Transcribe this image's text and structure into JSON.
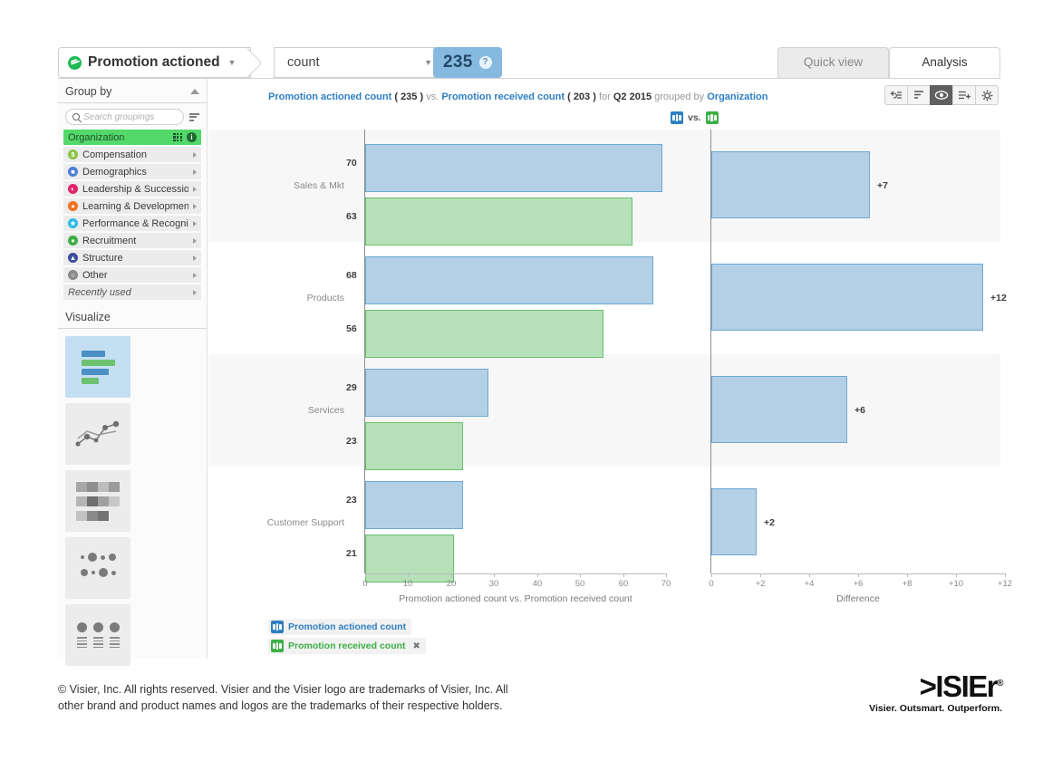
{
  "topbar": {
    "metric_name": "Promotion actioned",
    "metric_icon": "promotion-icon",
    "aggregation": "count",
    "value": "235",
    "help_badge": "?"
  },
  "view_tabs": [
    {
      "label": "Quick view",
      "active": false
    },
    {
      "label": "Analysis",
      "active": true
    }
  ],
  "sidebar": {
    "group_by_title": "Group by",
    "search_placeholder": "Search groupings",
    "items": [
      {
        "label": "Organization",
        "active": true,
        "color": "#53d86a"
      },
      {
        "label": "Compensation",
        "active": false,
        "color": "#8bc540",
        "glyph": "$"
      },
      {
        "label": "Demographics",
        "active": false,
        "color": "#4a7fd4",
        "glyph": "■"
      },
      {
        "label": "Leadership & Succession",
        "active": false,
        "color": "#e0246a",
        "glyph": "◔"
      },
      {
        "label": "Learning & Development",
        "active": false,
        "color": "#f4701f",
        "glyph": "ⓘ"
      },
      {
        "label": "Performance & Recognition",
        "active": false,
        "color": "#27b9e8",
        "glyph": "★"
      },
      {
        "label": "Recruitment",
        "active": false,
        "color": "#3dae46",
        "glyph": "⑂"
      },
      {
        "label": "Structure",
        "active": false,
        "color": "#3a4fa0",
        "glyph": "▲"
      },
      {
        "label": "Other",
        "active": false,
        "color": "#8a8a8a",
        "glyph": "●"
      },
      {
        "label": "Recently used",
        "active": false,
        "recent": true
      }
    ],
    "visualize_title": "Visualize",
    "visualizations": [
      {
        "name": "bar-chart",
        "selected": true
      },
      {
        "name": "line-chart",
        "selected": false
      },
      {
        "name": "heatmap-chart",
        "selected": false
      },
      {
        "name": "bubble-chart",
        "selected": false
      },
      {
        "name": "profile-table",
        "selected": false
      }
    ]
  },
  "breadcrumb": {
    "metric_a": "Promotion actioned count",
    "value_a": "( 235 )",
    "vs": "vs.",
    "metric_b": "Promotion received count",
    "value_b": "( 203 )",
    "for": "for",
    "period": "Q2 2015",
    "grouped_by": "grouped by",
    "group": "Organization"
  },
  "toolbar": [
    {
      "name": "undo-list-icon",
      "active": false
    },
    {
      "name": "sort-bars-icon",
      "active": false
    },
    {
      "name": "eye-icon",
      "active": true
    },
    {
      "name": "add-list-icon",
      "active": false
    },
    {
      "name": "gear-icon",
      "active": false
    }
  ],
  "vs_header": {
    "vs_text": "vs."
  },
  "legend": [
    {
      "label": "Promotion actioned count",
      "color": "#2e7fc1",
      "removable": false
    },
    {
      "label": "Promotion received count",
      "color": "#3dae46",
      "removable": true,
      "remove": "✖"
    }
  ],
  "chart_data": {
    "type": "bar",
    "title": "Promotion actioned count ( 235 ) vs. Promotion received count ( 203 ) for Q2 2015 grouped by Organization",
    "orientation": "horizontal",
    "categories": [
      "Sales & Mkt",
      "Products",
      "Services",
      "Customer Support"
    ],
    "series": [
      {
        "name": "Promotion actioned count",
        "color": "#b4d0e7",
        "values": [
          70,
          68,
          29,
          23
        ]
      },
      {
        "name": "Promotion received count",
        "color": "#b5e0b8",
        "values": [
          63,
          56,
          23,
          21
        ]
      }
    ],
    "totals": {
      "Promotion actioned count": 235,
      "Promotion received count": 203
    },
    "left_panel": {
      "xlabel": "Promotion actioned count vs. Promotion received count",
      "xlim": [
        0,
        70
      ],
      "xticks": [
        "0",
        "10",
        "20",
        "30",
        "40",
        "50",
        "60",
        "70"
      ]
    },
    "right_panel": {
      "xlabel": "Difference",
      "xlim": [
        0,
        12
      ],
      "xticks": [
        "0",
        "+2",
        "+4",
        "+6",
        "+8",
        "+10",
        "+12"
      ],
      "values": [
        7,
        12,
        6,
        2
      ],
      "labels": [
        "+7",
        "+12",
        "+6",
        "+2"
      ]
    },
    "grid": false,
    "legend_position": "bottom-left"
  },
  "footer": {
    "copyright_line1": "© Visier, Inc. All rights reserved. Visier and the Visier logo are trademarks of Visier, Inc. All",
    "copyright_line2": "other brand and product names and logos are the trademarks of their respective holders.",
    "logo_text": ">ISIEr",
    "logo_reg": "®",
    "logo_tagline": "Visier. Outsmart. Outperform."
  }
}
